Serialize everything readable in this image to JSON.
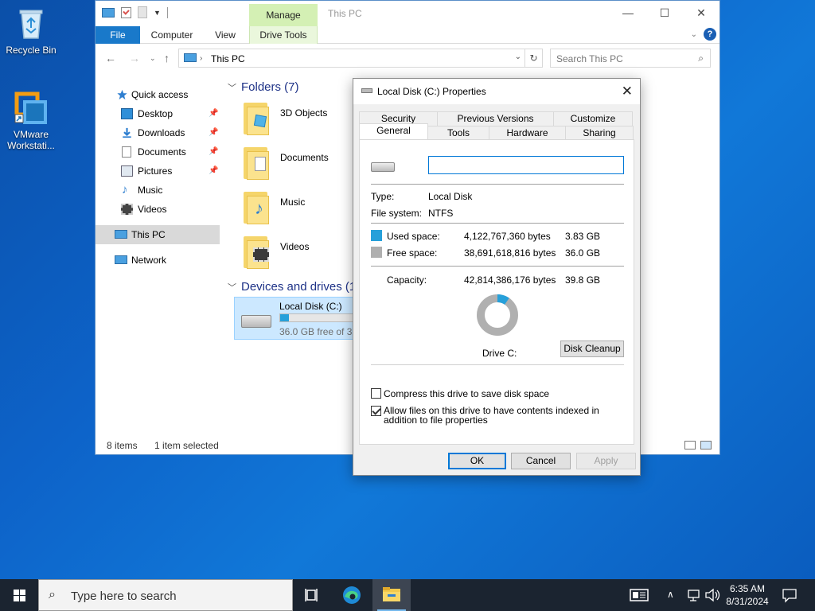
{
  "desktop": {
    "icons": [
      {
        "label": "Recycle Bin"
      },
      {
        "label": "VMware Workstati..."
      }
    ]
  },
  "explorer": {
    "title": "This PC",
    "manage_tab": "Manage",
    "ribbon_tabs": [
      "File",
      "Computer",
      "View",
      "Drive Tools"
    ],
    "address": "This PC",
    "search_placeholder": "Search This PC",
    "nav": {
      "quick_access": "Quick access",
      "items": [
        {
          "label": "Desktop",
          "icon": "desktop-icon",
          "pinned": true
        },
        {
          "label": "Downloads",
          "icon": "downloads-icon",
          "pinned": true
        },
        {
          "label": "Documents",
          "icon": "documents-icon",
          "pinned": true
        },
        {
          "label": "Pictures",
          "icon": "pictures-icon",
          "pinned": true
        },
        {
          "label": "Music",
          "icon": "music-icon",
          "pinned": false
        },
        {
          "label": "Videos",
          "icon": "videos-icon",
          "pinned": false
        }
      ],
      "this_pc": "This PC",
      "network": "Network"
    },
    "folders_header": "Folders (7)",
    "folders": [
      "3D Objects",
      "Documents",
      "Music",
      "Videos"
    ],
    "drives_header": "Devices and drives (1)",
    "drive": {
      "name": "Local Disk (C:)",
      "free_text": "36.0 GB free of 39.8 GB",
      "used_fraction": 0.096
    },
    "status": {
      "items": "8 items",
      "selected": "1 item selected"
    }
  },
  "dialog": {
    "title": "Local Disk (C:) Properties",
    "tabs_row1": [
      "Security",
      "Previous Versions",
      "Customize"
    ],
    "tabs_row2": [
      "General",
      "Tools",
      "Hardware",
      "Sharing"
    ],
    "active_tab": "General",
    "name_value": "",
    "type_label": "Type:",
    "type_value": "Local Disk",
    "fs_label": "File system:",
    "fs_value": "NTFS",
    "used_label": "Used space:",
    "used_bytes": "4,122,767,360 bytes",
    "used_gb": "3.83 GB",
    "free_label": "Free space:",
    "free_bytes": "38,691,618,816 bytes",
    "free_gb": "36.0 GB",
    "capacity_label": "Capacity:",
    "capacity_bytes": "42,814,386,176 bytes",
    "capacity_gb": "39.8 GB",
    "drive_label": "Drive C:",
    "disk_cleanup": "Disk Cleanup",
    "compress_label": "Compress this drive to save disk space",
    "compress_checked": false,
    "index_label": "Allow files on this drive to have contents indexed in addition to file properties",
    "index_checked": true,
    "ok": "OK",
    "cancel": "Cancel",
    "apply": "Apply",
    "colors": {
      "used": "#26a0da",
      "free": "#b0b0b0"
    }
  },
  "taskbar": {
    "search_placeholder": "Type here to search",
    "time": "6:35 AM",
    "date": "8/31/2024"
  }
}
